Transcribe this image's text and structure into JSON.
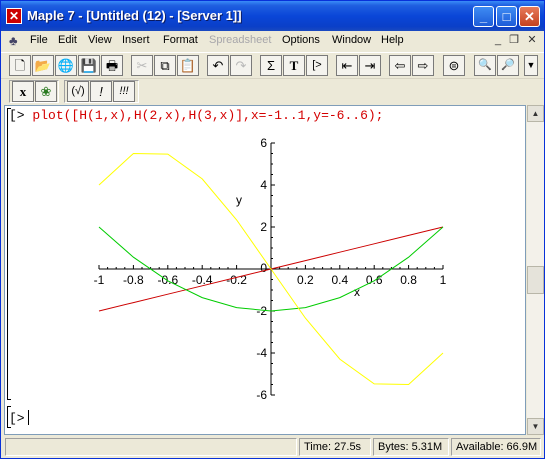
{
  "window": {
    "title": "Maple 7  - [Untitled (12) - [Server 1]]"
  },
  "menubar": {
    "items": [
      {
        "label": "File",
        "enabled": true
      },
      {
        "label": "Edit",
        "enabled": true
      },
      {
        "label": "View",
        "enabled": true
      },
      {
        "label": "Insert",
        "enabled": true
      },
      {
        "label": "Format",
        "enabled": true
      },
      {
        "label": "Spreadsheet",
        "enabled": false
      },
      {
        "label": "Options",
        "enabled": true
      },
      {
        "label": "Window",
        "enabled": true
      },
      {
        "label": "Help",
        "enabled": true
      }
    ]
  },
  "toolbar": {
    "math_text": "T",
    "sigma": "Σ",
    "exec_prompt": "[>",
    "x_label": "x",
    "check_label": "(√)",
    "bang_label": "!",
    "triple_bang_label": "!!!"
  },
  "worksheet": {
    "prompt": "[>",
    "command": "plot([H(1,x),H(2,x),H(3,x)],x=-1..1,y=-6..6);",
    "prompt2": "[>"
  },
  "chart_data": {
    "type": "line",
    "title": "",
    "xlabel": "x",
    "ylabel": "y",
    "xlim": [
      -1,
      1
    ],
    "ylim": [
      -6,
      6
    ],
    "x_ticks": [
      -1,
      -0.8,
      -0.6,
      -0.4,
      -0.2,
      0.2,
      0.4,
      0.6,
      0.8,
      1
    ],
    "x_tick_labels": [
      "-1",
      "-0.8",
      "-0.6",
      "-0.4",
      "-0.2",
      "0.2",
      "0.4",
      "0.6",
      "0.8",
      "1"
    ],
    "y_ticks": [
      6,
      4,
      2,
      -2,
      -4,
      -6
    ],
    "y_tick_labels": [
      "6",
      "4",
      "2",
      "-2",
      "-4",
      "-6"
    ],
    "origin_label": "0",
    "grid": false,
    "series": [
      {
        "color": "#cc0000",
        "x": [
          -1,
          -0.8,
          -0.6,
          -0.4,
          -0.2,
          0,
          0.2,
          0.4,
          0.6,
          0.8,
          1
        ],
        "y": [
          -2,
          -1.6,
          -1.2,
          -0.8,
          -0.4,
          0,
          0.4,
          0.8,
          1.2,
          1.6,
          2
        ]
      },
      {
        "color": "#00cc00",
        "x": [
          -1,
          -0.8,
          -0.6,
          -0.4,
          -0.2,
          0,
          0.2,
          0.4,
          0.6,
          0.8,
          1
        ],
        "y": [
          2,
          0.56,
          -0.56,
          -1.36,
          -1.84,
          -2,
          -1.84,
          -1.36,
          -0.56,
          0.56,
          2
        ]
      },
      {
        "color": "#ffff00",
        "x": [
          -1,
          -0.8,
          -0.6,
          -0.4,
          -0.2,
          0,
          0.2,
          0.4,
          0.6,
          0.8,
          1
        ],
        "y": [
          4,
          5.5,
          5.47,
          4.29,
          2.34,
          0,
          -2.34,
          -4.29,
          -5.47,
          -5.5,
          -4
        ]
      }
    ]
  },
  "status": {
    "time": "Time:  27.5s",
    "bytes": "Bytes: 5.31M",
    "available": "Available: 66.9M"
  }
}
